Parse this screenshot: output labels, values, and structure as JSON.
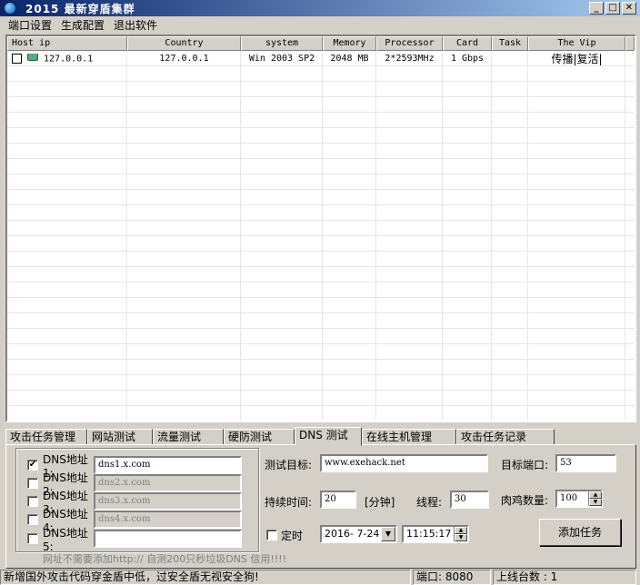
{
  "window": {
    "title": "2015   最新穿盾集群"
  },
  "menu": [
    "端口设置",
    "生成配置",
    "退出软件"
  ],
  "table": {
    "columns": [
      "Host ip",
      "Country",
      "system",
      "Memory",
      "Processor",
      "Card",
      "Task",
      "The Vip"
    ],
    "rows": [
      {
        "checked": false,
        "host": "127.0.0.1",
        "country": "127.0.0.1",
        "system": "Win 2003 SP2",
        "memory": "2048 MB",
        "processor": "2*2593MHz",
        "card": "1 Gbps",
        "task": "",
        "vip": "传播|复活|"
      }
    ]
  },
  "tabs": [
    "攻击任务管理",
    "网站测试",
    "流量测试",
    "硬防测试",
    "DNS 测试",
    "在线主机管理",
    "攻击任务记录"
  ],
  "active_tab": "DNS 测试",
  "dns": {
    "items": [
      {
        "label": "DNS地址1:",
        "value": "dns1.x.com",
        "checked": true,
        "enabled": true
      },
      {
        "label": "DNS地址2:",
        "value": "dns2.x.com",
        "checked": false,
        "enabled": false
      },
      {
        "label": "DNS地址3:",
        "value": "dns3.x.com",
        "checked": false,
        "enabled": false
      },
      {
        "label": "DNS地址4:",
        "value": "dns4.x.com",
        "checked": false,
        "enabled": false
      },
      {
        "label": "DNS地址5:",
        "value": "",
        "checked": false,
        "enabled": true
      }
    ],
    "hint": "网址不需要添加http:// 自测200只秒垃圾DNS 信用!!!!"
  },
  "form": {
    "target_label": "测试目标:",
    "target_value": "www.exehack.net",
    "port_label": "目标端口:",
    "port_value": "53",
    "duration_label": "持续时间:",
    "duration_value": "20",
    "duration_unit": "[分钟]",
    "threads_label": "线程:",
    "threads_value": "30",
    "bots_label": "肉鸡数量:",
    "bots_value": "100",
    "schedule_label": "定时",
    "date_value": "2016- 7-24",
    "time_value": "11:15:17",
    "add_button": "添加任务"
  },
  "status": {
    "message": "新增国外攻击代码穿金盾中低，过安全盾无视安全狗!",
    "port": "端口: 8080",
    "online": "上线台数    : 1"
  }
}
